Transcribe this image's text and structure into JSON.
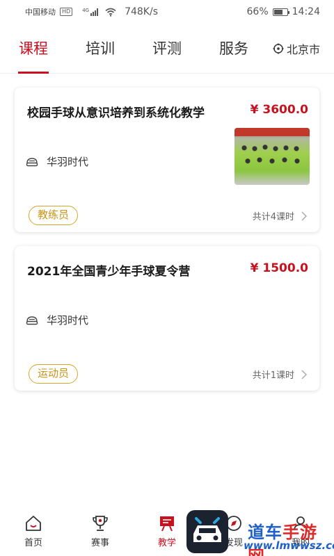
{
  "status_bar": {
    "carrier": "中国移动",
    "hd": "HD",
    "network": "4G",
    "speed": "748K/s",
    "battery_percent": "66%",
    "battery_level": 0.66,
    "time": "14:24"
  },
  "tabs": [
    {
      "label": "课程",
      "active": true
    },
    {
      "label": "培训",
      "active": false
    },
    {
      "label": "评测",
      "active": false
    },
    {
      "label": "服务",
      "active": false
    }
  ],
  "location": {
    "city": "北京市",
    "icon": "location-target-icon"
  },
  "courses": [
    {
      "title": "校园手球从意识培养到系统化教学",
      "price": "¥ 3600.0",
      "org": "华羽时代",
      "tag": "教练员",
      "lessons": "共计4课时",
      "has_thumbnail": true
    },
    {
      "title": "2021年全国青少年手球夏令营",
      "price": "¥ 1500.0",
      "org": "华羽时代",
      "tag": "运动员",
      "lessons": "共计1课时",
      "has_thumbnail": false
    }
  ],
  "bottom_nav": [
    {
      "label": "首页",
      "icon": "home-icon",
      "active": false
    },
    {
      "label": "赛事",
      "icon": "trophy-icon",
      "active": false
    },
    {
      "label": "教学",
      "icon": "teaching-icon",
      "active": true
    },
    {
      "label": "发现",
      "icon": "compass-icon",
      "active": false
    },
    {
      "label": "我的",
      "icon": "profile-icon",
      "active": false
    }
  ],
  "watermark": {
    "brand": "道车手游网",
    "url": "www.lmwwsz.com"
  },
  "colors": {
    "accent": "#c8101e",
    "tag_gold": "#d4a62a",
    "watermark_blue": "#1e5fc8",
    "watermark_red": "#e02a2a"
  }
}
